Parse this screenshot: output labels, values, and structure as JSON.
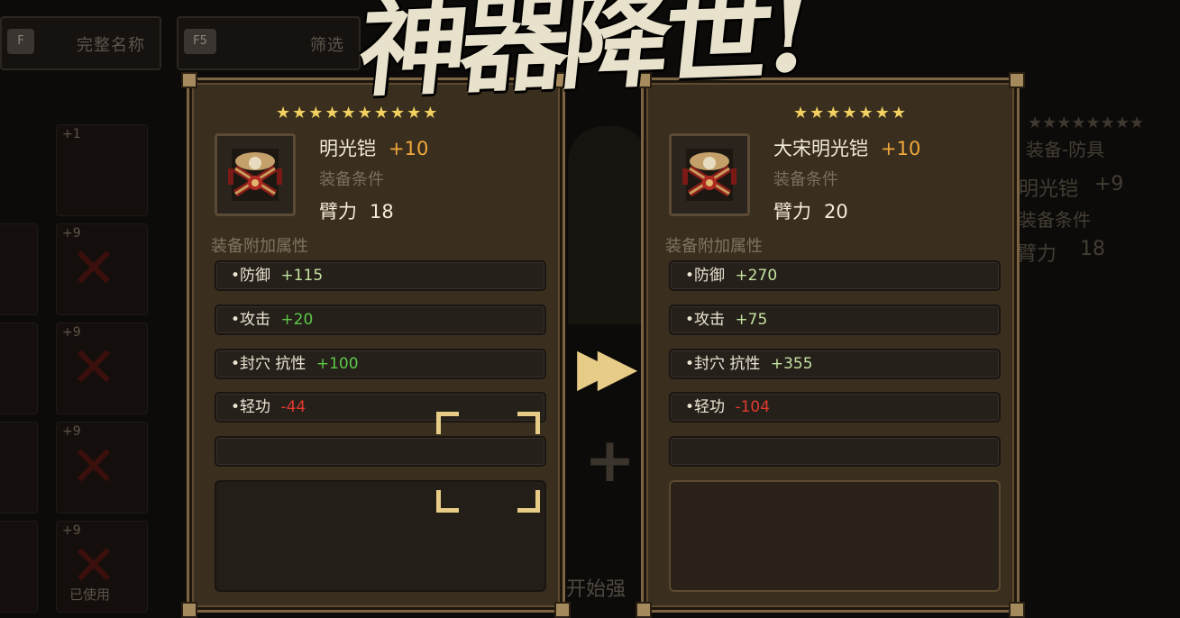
{
  "top_bar": {
    "f_key": "F",
    "f_label": "完整名称",
    "f5_key": "F5",
    "f5_label": "筛选"
  },
  "title": "神器降世!",
  "background": {
    "slot_plus": "+9",
    "slot_plus_1": "+1",
    "used_label": "已使用",
    "right_type": "装备-防具",
    "right_name": "明光铠",
    "right_level": "+9",
    "right_cond": "装备条件",
    "right_req": "臂力",
    "right_req_val": "18"
  },
  "center": {
    "start_label": "开始强"
  },
  "left_card": {
    "stars": "★★★★★★★★★★",
    "name": "明光铠",
    "level": "+10",
    "condition_label": "装备条件",
    "req_label": "臂力",
    "req_value": "18",
    "section_label": "装备附加属性",
    "attrs": [
      {
        "label": "•防御",
        "value": "+115",
        "tone": "lightgreen"
      },
      {
        "label": "•攻击",
        "value": "+20",
        "tone": "green"
      },
      {
        "label": "•封穴 抗性",
        "value": "+100",
        "tone": "green"
      },
      {
        "label": "•轻功",
        "value": "-44",
        "tone": "red"
      }
    ]
  },
  "right_card": {
    "stars": "★★★★★★★",
    "name": "大宋明光铠",
    "level": "+10",
    "condition_label": "装备条件",
    "req_label": "臂力",
    "req_value": "20",
    "section_label": "装备附加属性",
    "attrs": [
      {
        "label": "•防御",
        "value": "+270",
        "tone": "lightgreen"
      },
      {
        "label": "•攻击",
        "value": "+75",
        "tone": "lightgreen"
      },
      {
        "label": "•封穴 抗性",
        "value": "+355",
        "tone": "lightgreen"
      },
      {
        "label": "•轻功",
        "value": "-104",
        "tone": "red"
      }
    ]
  },
  "colors": {
    "accent_gold": "#e6cc86",
    "level_orange": "#f0a93a",
    "positive_green": "#5ec84a",
    "negative_red": "#e03a2e"
  }
}
